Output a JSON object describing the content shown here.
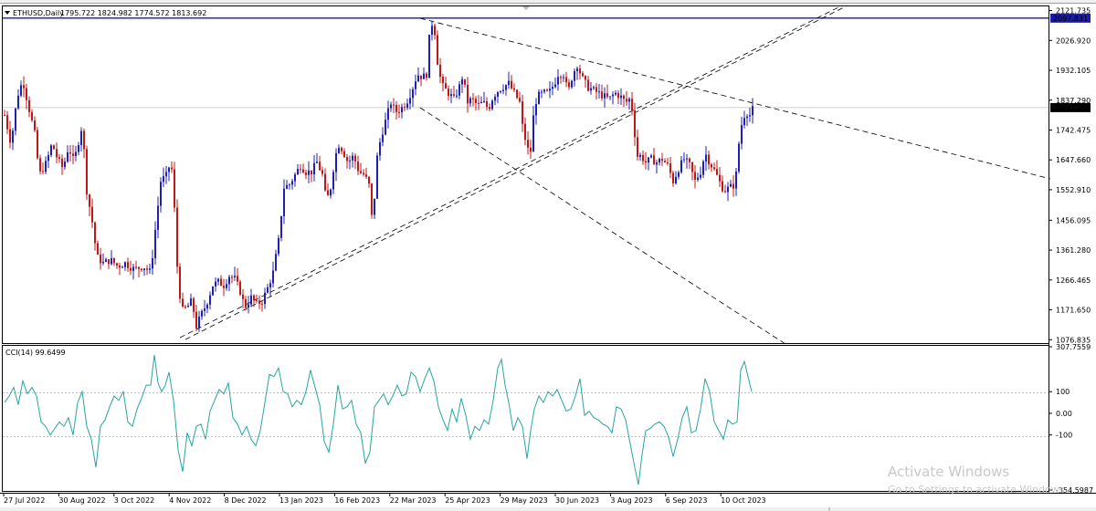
{
  "header": {
    "symbol_label": "ETHUSD,Daily",
    "ohlc": "1795.722 1824.982 1774.572 1813.692"
  },
  "indicator": {
    "label": "CCI(14) 99.6499",
    "value": 99.6499
  },
  "watermark": {
    "title": "Activate Windows",
    "subtitle": "Go to Settings to activate Windows."
  },
  "colors": {
    "bull": "#1f1fb8",
    "bear": "#c01818",
    "horizontal_line": "#1a1aa6",
    "cci_line": "#27a5a0",
    "grid": "#c0c0c0",
    "trend": "#000000"
  },
  "chart_data": [
    {
      "type": "candlestick",
      "title": "ETHUSD,Daily",
      "price_axis_ticks": [
        "2121.735",
        "2026.920",
        "1932.105",
        "1837.290",
        "1742.475",
        "1647.660",
        "1552.910",
        "1456.095",
        "1361.280",
        "1266.465",
        "1171.650",
        "1076.835"
      ],
      "ylim": [
        1066,
        2135
      ],
      "date_labels": [
        "27 Jul 2022",
        "30 Aug 2022",
        "3 Oct 2022",
        "4 Nov 2022",
        "8 Dec 2022",
        "13 Jan 2023",
        "16 Feb 2023",
        "22 Mar 2023",
        "25 Apr 2023",
        "29 May 2023",
        "30 Jun 2023",
        "3 Aug 2023",
        "6 Sep 2023",
        "10 Oct 2023"
      ],
      "horizontal_line": {
        "price": 2097.831,
        "label": "2097.831"
      },
      "current_price": {
        "price": 1813.692,
        "label": "1813.692"
      },
      "close_path": [
        [
          0,
          1790
        ],
        [
          7,
          1700
        ],
        [
          14,
          1850
        ],
        [
          20,
          1900
        ],
        [
          26,
          1820
        ],
        [
          33,
          1730
        ],
        [
          38,
          1600
        ],
        [
          46,
          1640
        ],
        [
          52,
          1700
        ],
        [
          58,
          1650
        ],
        [
          64,
          1620
        ],
        [
          70,
          1690
        ],
        [
          76,
          1640
        ],
        [
          85,
          1760
        ],
        [
          90,
          1550
        ],
        [
          96,
          1450
        ],
        [
          101,
          1340
        ],
        [
          108,
          1320
        ],
        [
          116,
          1330
        ],
        [
          124,
          1310
        ],
        [
          132,
          1320
        ],
        [
          142,
          1300
        ],
        [
          152,
          1310
        ],
        [
          160,
          1290
        ],
        [
          164,
          1400
        ],
        [
          171,
          1580
        ],
        [
          178,
          1600
        ],
        [
          182,
          1650
        ],
        [
          185,
          1550
        ],
        [
          190,
          1250
        ],
        [
          195,
          1170
        ],
        [
          200,
          1180
        ],
        [
          205,
          1200
        ],
        [
          210,
          1120
        ],
        [
          216,
          1160
        ],
        [
          221,
          1190
        ],
        [
          228,
          1250
        ],
        [
          234,
          1260
        ],
        [
          240,
          1250
        ],
        [
          246,
          1280
        ],
        [
          252,
          1270
        ],
        [
          258,
          1230
        ],
        [
          263,
          1180
        ],
        [
          270,
          1210
        ],
        [
          276,
          1190
        ],
        [
          282,
          1200
        ],
        [
          288,
          1240
        ],
        [
          294,
          1290
        ],
        [
          300,
          1390
        ],
        [
          306,
          1560
        ],
        [
          312,
          1570
        ],
        [
          318,
          1600
        ],
        [
          324,
          1630
        ],
        [
          330,
          1610
        ],
        [
          336,
          1610
        ],
        [
          342,
          1640
        ],
        [
          348,
          1600
        ],
        [
          352,
          1520
        ],
        [
          356,
          1540
        ],
        [
          360,
          1620
        ],
        [
          365,
          1700
        ],
        [
          370,
          1680
        ],
        [
          376,
          1640
        ],
        [
          382,
          1660
        ],
        [
          388,
          1610
        ],
        [
          394,
          1600
        ],
        [
          400,
          1560
        ],
        [
          403,
          1420
        ],
        [
          407,
          1640
        ],
        [
          412,
          1720
        ],
        [
          418,
          1780
        ],
        [
          423,
          1830
        ],
        [
          428,
          1800
        ],
        [
          434,
          1810
        ],
        [
          440,
          1830
        ],
        [
          446,
          1870
        ],
        [
          452,
          1920
        ],
        [
          458,
          1910
        ],
        [
          462,
          1920
        ],
        [
          466,
          2070
        ],
        [
          470,
          2090
        ],
        [
          473,
          1980
        ],
        [
          476,
          1920
        ],
        [
          480,
          1880
        ],
        [
          486,
          1860
        ],
        [
          492,
          1840
        ],
        [
          498,
          1880
        ],
        [
          502,
          1920
        ],
        [
          506,
          1830
        ],
        [
          512,
          1840
        ],
        [
          518,
          1820
        ],
        [
          524,
          1830
        ],
        [
          530,
          1810
        ],
        [
          535,
          1850
        ],
        [
          541,
          1870
        ],
        [
          546,
          1880
        ],
        [
          552,
          1890
        ],
        [
          558,
          1860
        ],
        [
          564,
          1830
        ],
        [
          568,
          1730
        ],
        [
          572,
          1700
        ],
        [
          575,
          1640
        ],
        [
          580,
          1820
        ],
        [
          584,
          1850
        ],
        [
          590,
          1860
        ],
        [
          596,
          1860
        ],
        [
          602,
          1890
        ],
        [
          606,
          1920
        ],
        [
          612,
          1920
        ],
        [
          617,
          1860
        ],
        [
          622,
          1920
        ],
        [
          627,
          1950
        ],
        [
          632,
          1910
        ],
        [
          638,
          1880
        ],
        [
          644,
          1870
        ],
        [
          650,
          1860
        ],
        [
          656,
          1850
        ],
        [
          662,
          1840
        ],
        [
          668,
          1860
        ],
        [
          674,
          1850
        ],
        [
          680,
          1830
        ],
        [
          684,
          1840
        ],
        [
          688,
          1800
        ],
        [
          692,
          1660
        ],
        [
          697,
          1660
        ],
        [
          702,
          1640
        ],
        [
          708,
          1650
        ],
        [
          714,
          1640
        ],
        [
          720,
          1650
        ],
        [
          726,
          1630
        ],
        [
          732,
          1580
        ],
        [
          738,
          1620
        ],
        [
          744,
          1650
        ],
        [
          750,
          1630
        ],
        [
          756,
          1580
        ],
        [
          762,
          1610
        ],
        [
          767,
          1670
        ],
        [
          772,
          1640
        ],
        [
          778,
          1610
        ],
        [
          784,
          1570
        ],
        [
          788,
          1550
        ],
        [
          794,
          1560
        ],
        [
          800,
          1570
        ],
        [
          804,
          1700
        ],
        [
          808,
          1780
        ],
        [
          812,
          1800
        ],
        [
          816,
          1790
        ],
        [
          820,
          1813.7
        ]
      ],
      "cci_axis_ticks": [
        "307.7559",
        "100",
        "0.00",
        "-100",
        "-354.5987"
      ],
      "cci_ylim": [
        -354.6,
        307.76
      ],
      "cci_values": [
        [
          0,
          50
        ],
        [
          5,
          80
        ],
        [
          10,
          120
        ],
        [
          15,
          40
        ],
        [
          20,
          150
        ],
        [
          25,
          90
        ],
        [
          30,
          120
        ],
        [
          35,
          80
        ],
        [
          40,
          -40
        ],
        [
          45,
          -60
        ],
        [
          50,
          -100
        ],
        [
          55,
          -70
        ],
        [
          60,
          -40
        ],
        [
          65,
          -60
        ],
        [
          70,
          -20
        ],
        [
          75,
          -100
        ],
        [
          80,
          50
        ],
        [
          85,
          100
        ],
        [
          90,
          -60
        ],
        [
          95,
          -120
        ],
        [
          100,
          -250
        ],
        [
          105,
          -60
        ],
        [
          110,
          -30
        ],
        [
          115,
          30
        ],
        [
          120,
          80
        ],
        [
          125,
          60
        ],
        [
          130,
          100
        ],
        [
          135,
          -40
        ],
        [
          140,
          -60
        ],
        [
          145,
          20
        ],
        [
          150,
          70
        ],
        [
          155,
          130
        ],
        [
          160,
          130
        ],
        [
          164,
          270
        ],
        [
          168,
          140
        ],
        [
          172,
          100
        ],
        [
          176,
          130
        ],
        [
          180,
          190
        ],
        [
          185,
          60
        ],
        [
          190,
          -170
        ],
        [
          195,
          -270
        ],
        [
          200,
          -90
        ],
        [
          205,
          -150
        ],
        [
          210,
          -60
        ],
        [
          215,
          -50
        ],
        [
          220,
          -120
        ],
        [
          225,
          10
        ],
        [
          230,
          60
        ],
        [
          235,
          110
        ],
        [
          240,
          90
        ],
        [
          245,
          140
        ],
        [
          250,
          -20
        ],
        [
          255,
          -50
        ],
        [
          260,
          -100
        ],
        [
          265,
          -60
        ],
        [
          270,
          -120
        ],
        [
          275,
          -150
        ],
        [
          280,
          -80
        ],
        [
          285,
          50
        ],
        [
          290,
          180
        ],
        [
          295,
          170
        ],
        [
          300,
          210
        ],
        [
          305,
          100
        ],
        [
          310,
          90
        ],
        [
          315,
          30
        ],
        [
          320,
          60
        ],
        [
          325,
          40
        ],
        [
          330,
          100
        ],
        [
          335,
          200
        ],
        [
          340,
          120
        ],
        [
          345,
          40
        ],
        [
          350,
          -130
        ],
        [
          355,
          -180
        ],
        [
          360,
          -50
        ],
        [
          365,
          130
        ],
        [
          370,
          20
        ],
        [
          375,
          30
        ],
        [
          380,
          60
        ],
        [
          385,
          -50
        ],
        [
          390,
          -90
        ],
        [
          395,
          -230
        ],
        [
          400,
          -180
        ],
        [
          405,
          30
        ],
        [
          410,
          60
        ],
        [
          415,
          90
        ],
        [
          420,
          40
        ],
        [
          425,
          80
        ],
        [
          430,
          130
        ],
        [
          435,
          80
        ],
        [
          440,
          90
        ],
        [
          445,
          190
        ],
        [
          450,
          170
        ],
        [
          455,
          100
        ],
        [
          460,
          160
        ],
        [
          465,
          210
        ],
        [
          470,
          150
        ],
        [
          475,
          30
        ],
        [
          480,
          -30
        ],
        [
          485,
          -80
        ],
        [
          490,
          20
        ],
        [
          495,
          -40
        ],
        [
          500,
          70
        ],
        [
          505,
          -10
        ],
        [
          510,
          -120
        ],
        [
          515,
          -60
        ],
        [
          520,
          -80
        ],
        [
          525,
          -30
        ],
        [
          530,
          -50
        ],
        [
          535,
          60
        ],
        [
          540,
          210
        ],
        [
          544,
          250
        ],
        [
          548,
          130
        ],
        [
          552,
          50
        ],
        [
          557,
          -80
        ],
        [
          562,
          -20
        ],
        [
          567,
          -60
        ],
        [
          572,
          -210
        ],
        [
          576,
          -80
        ],
        [
          580,
          20
        ],
        [
          585,
          80
        ],
        [
          590,
          50
        ],
        [
          595,
          100
        ],
        [
          600,
          80
        ],
        [
          605,
          110
        ],
        [
          610,
          60
        ],
        [
          615,
          10
        ],
        [
          620,
          20
        ],
        [
          625,
          80
        ],
        [
          630,
          160
        ],
        [
          635,
          -10
        ],
        [
          640,
          10
        ],
        [
          645,
          -20
        ],
        [
          650,
          -30
        ],
        [
          655,
          -50
        ],
        [
          660,
          -60
        ],
        [
          665,
          -90
        ],
        [
          670,
          30
        ],
        [
          675,
          20
        ],
        [
          680,
          -30
        ],
        [
          685,
          -140
        ],
        [
          690,
          -250
        ],
        [
          694,
          -330
        ],
        [
          698,
          -190
        ],
        [
          702,
          -80
        ],
        [
          707,
          -70
        ],
        [
          712,
          -50
        ],
        [
          717,
          -40
        ],
        [
          722,
          -60
        ],
        [
          727,
          -110
        ],
        [
          732,
          -200
        ],
        [
          737,
          -120
        ],
        [
          742,
          -20
        ],
        [
          747,
          30
        ],
        [
          752,
          -90
        ],
        [
          757,
          -80
        ],
        [
          762,
          20
        ],
        [
          767,
          160
        ],
        [
          772,
          100
        ],
        [
          777,
          -40
        ],
        [
          782,
          -80
        ],
        [
          787,
          -120
        ],
        [
          792,
          -30
        ],
        [
          797,
          -50
        ],
        [
          802,
          -40
        ],
        [
          806,
          200
        ],
        [
          810,
          240
        ],
        [
          814,
          170
        ],
        [
          818,
          99.65
        ]
      ]
    }
  ]
}
